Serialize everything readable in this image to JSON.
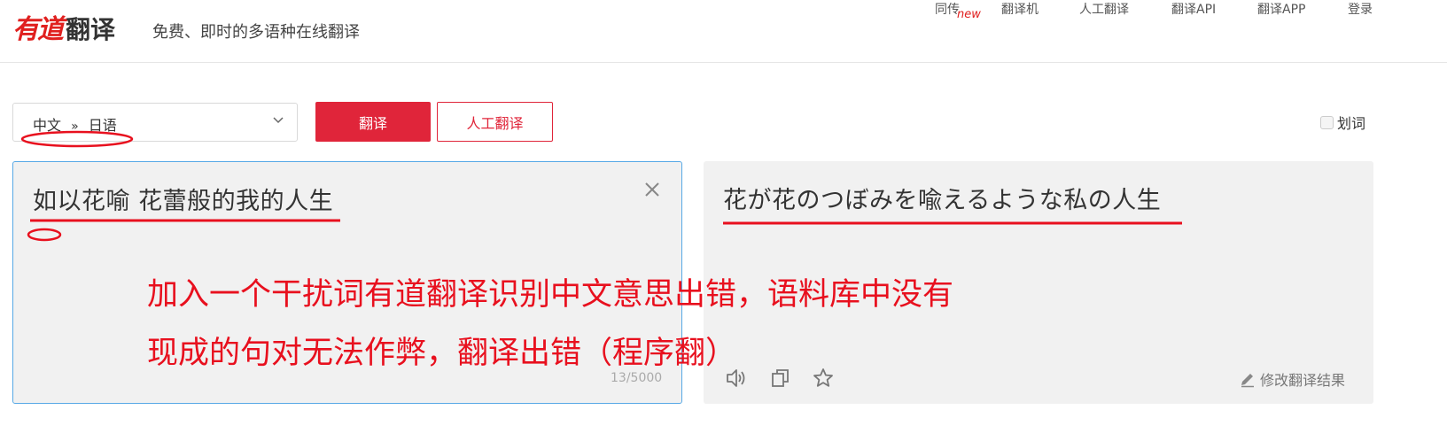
{
  "header": {
    "logo_red": "有道",
    "logo_gray": "翻译",
    "slogan": "免费、即时的多语种在线翻译",
    "nav": [
      {
        "label": "同传"
      },
      {
        "label": "翻译机"
      },
      {
        "label": "人工翻译"
      },
      {
        "label": "翻译API"
      },
      {
        "label": "翻译APP"
      },
      {
        "label": "登录"
      }
    ],
    "new_badge": "new"
  },
  "toolbar": {
    "lang_from": "中文",
    "lang_sep": "»",
    "lang_to": "日语",
    "translate_label": "翻译",
    "human_translate_label": "人工翻译",
    "huaci_label": "划词"
  },
  "input": {
    "text": "如以花喻 花蕾般的我的人生",
    "char_count": "13/5000"
  },
  "output": {
    "text": "花が花のつぼみを喩えるような私の人生",
    "edit_label": "修改翻译结果"
  },
  "annotation": {
    "line1": "加入一个干扰词有道翻译识别中文意思出错，语料库中没有",
    "line2": "现成的句对无法作弊，翻译出错（程序翻）"
  },
  "colors": {
    "brand_red": "#e0253a",
    "input_border": "#58a9e6",
    "annotation_red": "#e8101e"
  }
}
